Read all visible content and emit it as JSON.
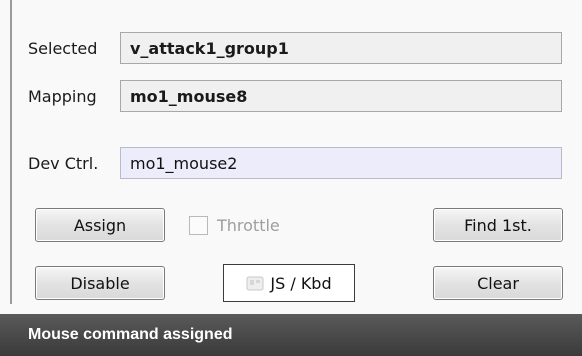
{
  "fields": {
    "selected_label": "Selected",
    "selected_value": "v_attack1_group1",
    "mapping_label": "Mapping",
    "mapping_value": "mo1_mouse8",
    "devctrl_label": "Dev Ctrl.",
    "devctrl_value": "mo1_mouse2"
  },
  "buttons": {
    "assign": "Assign",
    "throttle": "Throttle",
    "throttle_checked": false,
    "throttle_enabled": false,
    "find_first": "Find 1st.",
    "disable": "Disable",
    "js_kbd": "JS / Kbd",
    "clear": "Clear"
  },
  "status": {
    "message": "Mouse command assigned"
  },
  "colors": {
    "status_bar": "#444444",
    "dev_ctrl_bg": "#ececfb"
  }
}
